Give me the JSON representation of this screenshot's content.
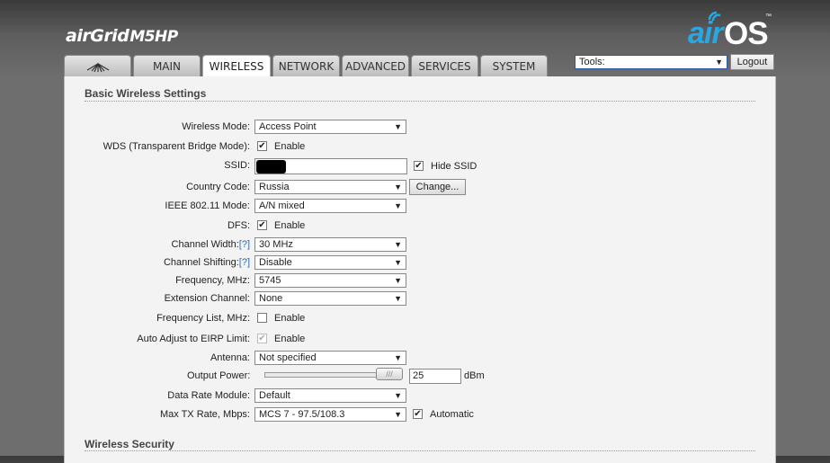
{
  "header": {
    "brand_air": "air",
    "brand_grid": "Grid",
    "brand_model": "M5HP",
    "logo_air": "air",
    "logo_os": "OS",
    "logo_tm": "™",
    "tools_select": "Tools:",
    "logout_label": "Logout"
  },
  "tabs": {
    "ubnt_icon": "ubiquiti-logo-icon",
    "main": "MAIN",
    "wireless": "WIRELESS",
    "network": "NETWORK",
    "advanced": "ADVANCED",
    "services": "SERVICES",
    "system": "SYSTEM"
  },
  "basic": {
    "title": "Basic Wireless Settings",
    "wireless_mode": {
      "label": "Wireless Mode:",
      "value": "Access Point"
    },
    "wds": {
      "label": "WDS (Transparent Bridge Mode):",
      "checkbox_label": "Enable",
      "checked": true
    },
    "ssid": {
      "label": "SSID:",
      "value": "",
      "hide_label": "Hide SSID",
      "hide_checked": true
    },
    "country": {
      "label": "Country Code:",
      "value": "Russia",
      "change_label": "Change..."
    },
    "ieee": {
      "label": "IEEE 802.11 Mode:",
      "value": "A/N mixed"
    },
    "dfs": {
      "label": "DFS:",
      "checkbox_label": "Enable",
      "checked": true
    },
    "channel_width": {
      "label": "Channel Width:",
      "help": "[?]",
      "value": "30 MHz"
    },
    "channel_shifting": {
      "label": "Channel Shifting:",
      "help": "[?]",
      "value": "Disable"
    },
    "frequency": {
      "label": "Frequency, MHz:",
      "value": "5745"
    },
    "extension": {
      "label": "Extension Channel:",
      "value": "None"
    },
    "freq_list": {
      "label": "Frequency List, MHz:",
      "checkbox_label": "Enable",
      "checked": false
    },
    "auto_adjust": {
      "label": "Auto Adjust to EIRP Limit:",
      "checkbox_label": "Enable",
      "checked": true
    },
    "antenna": {
      "label": "Antenna:",
      "value": "Not specified"
    },
    "output_power": {
      "label": "Output Power:",
      "value": "25",
      "unit": "dBm",
      "level": 1.0
    },
    "data_rate": {
      "label": "Data Rate Module:",
      "value": "Default"
    },
    "max_tx": {
      "label": "Max TX Rate, Mbps:",
      "value": "MCS 7 - 97.5/108.3",
      "auto_label": "Automatic",
      "auto_checked": true
    }
  },
  "security": {
    "title": "Wireless Security"
  },
  "colors": {
    "accent": "#2aa7e0",
    "help_link": "#2a6ebb"
  }
}
